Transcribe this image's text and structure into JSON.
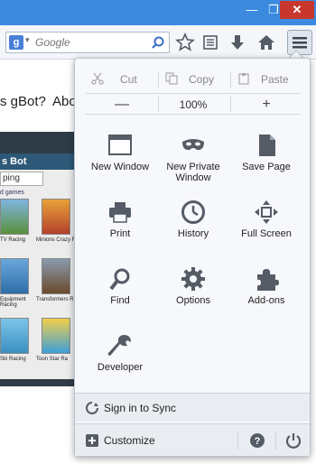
{
  "window": {
    "min_glyph": "—",
    "max_glyph": "❐",
    "close_glyph": "✕"
  },
  "navbar": {
    "search_engine_letter": "g",
    "search_placeholder": "Google"
  },
  "page": {
    "text_fragment_1": "s gBot?",
    "text_fragment_2": "Abo",
    "panel": {
      "title": "s Bot",
      "search_text": "ping",
      "section": "d games",
      "tiles": [
        "TV Racing",
        "Minions Crazy R",
        "Equipment Racing",
        "Transformers R",
        "Ski Racing",
        "Toon Star Ra"
      ]
    }
  },
  "menu": {
    "edit": {
      "cut": "Cut",
      "copy": "Copy",
      "paste": "Paste"
    },
    "zoom": {
      "minus": "—",
      "value": "100%",
      "plus": "+"
    },
    "tools": [
      {
        "label": "New Window",
        "icon": "new-window-icon"
      },
      {
        "label": "New Private Window",
        "icon": "private-mask-icon"
      },
      {
        "label": "Save Page",
        "icon": "save-page-icon"
      },
      {
        "label": "Print",
        "icon": "printer-icon"
      },
      {
        "label": "History",
        "icon": "clock-icon"
      },
      {
        "label": "Full Screen",
        "icon": "fullscreen-icon"
      },
      {
        "label": "Find",
        "icon": "magnifier-icon"
      },
      {
        "label": "Options",
        "icon": "gear-icon"
      },
      {
        "label": "Add-ons",
        "icon": "puzzle-icon"
      },
      {
        "label": "Developer",
        "icon": "wrench-icon"
      }
    ],
    "sync_label": "Sign in to Sync",
    "customize_label": "Customize"
  },
  "colors": {
    "titlebar": "#3b8ae0",
    "close": "#c7372d",
    "icon": "#555c66"
  }
}
